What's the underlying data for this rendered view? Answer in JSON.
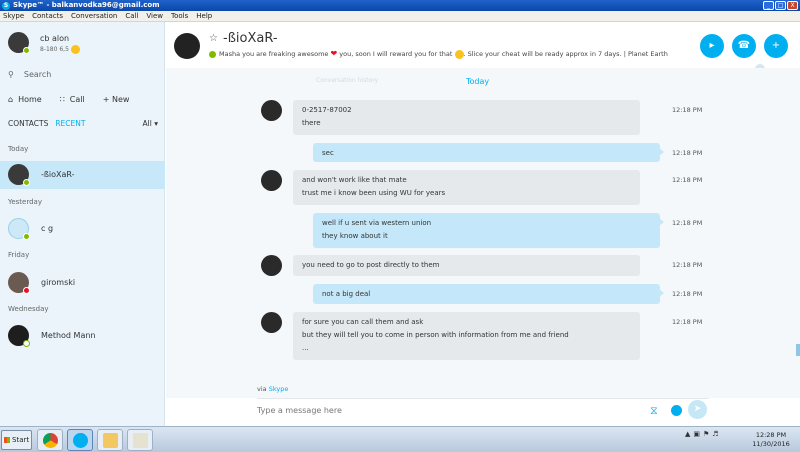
{
  "window": {
    "title": "Skype™ - balkanvodka96@gmail.com",
    "controls": [
      "_",
      "□",
      "X"
    ]
  },
  "menu": [
    "Skype",
    "Contacts",
    "Conversation",
    "Call",
    "View",
    "Tools",
    "Help"
  ],
  "profile": {
    "name": "cb alon",
    "mood": "8-180 6,5"
  },
  "search": {
    "placeholder": "Search"
  },
  "nav": {
    "home": "Home",
    "call": "Call",
    "new": "+  New"
  },
  "tabs": {
    "contacts": "CONTACTS",
    "recent": "RECENT",
    "filter": "All ▾"
  },
  "sections": {
    "today": "Today",
    "yesterday": "Yesterday",
    "friday": "Friday",
    "wednesday": "Wednesday"
  },
  "contacts": [
    {
      "name": "-ßioXaR-",
      "status": "online"
    },
    {
      "name": "c g",
      "status": "online"
    },
    {
      "name": "giromski",
      "status": "busy"
    },
    {
      "name": "Method Mann",
      "status": "away"
    }
  ],
  "conversation": {
    "name": "-ßioXaR-",
    "mood_a": "Masha you are freaking awesome",
    "mood_b": "you, soon I will reward you for that",
    "mood_c": ". Slice your cheat will be ready approx in 7 days.  | Planet Earth",
    "day_label": "Today",
    "faint_text": "Conversation history"
  },
  "messages": [
    {
      "dir": "in",
      "lines": [
        "0-2517-87002",
        "there"
      ],
      "time": "12:18 PM"
    },
    {
      "dir": "out",
      "lines": [
        "sec"
      ],
      "time": "12:18 PM"
    },
    {
      "dir": "in",
      "lines": [
        "and won't work like that mate",
        "trust me i know been using WU for years"
      ],
      "time": "12:18 PM"
    },
    {
      "dir": "out",
      "lines": [
        "well if u sent via western union",
        "they know about it"
      ],
      "time": "12:18 PM"
    },
    {
      "dir": "in",
      "lines": [
        "you need to go to post directly to them"
      ],
      "time": "12:18 PM"
    },
    {
      "dir": "out",
      "lines": [
        "not a big deal"
      ],
      "time": "12:18 PM"
    },
    {
      "dir": "in",
      "lines": [
        "for sure you can call them and ask",
        "but they will tell you to come in person with information from me and friend",
        "..."
      ],
      "time": "12:18 PM"
    }
  ],
  "via": {
    "prefix": "via",
    "app": "Skype"
  },
  "composer": {
    "placeholder": "Type a message here"
  },
  "taskbar": {
    "start": "Start",
    "time": "12:28 PM",
    "date": "11/30/2016"
  },
  "colors": {
    "accent": "#00aff0",
    "sidebar": "#eaf4fa",
    "incoming": "#e5e9ec",
    "outgoing": "#c4e8f9"
  }
}
